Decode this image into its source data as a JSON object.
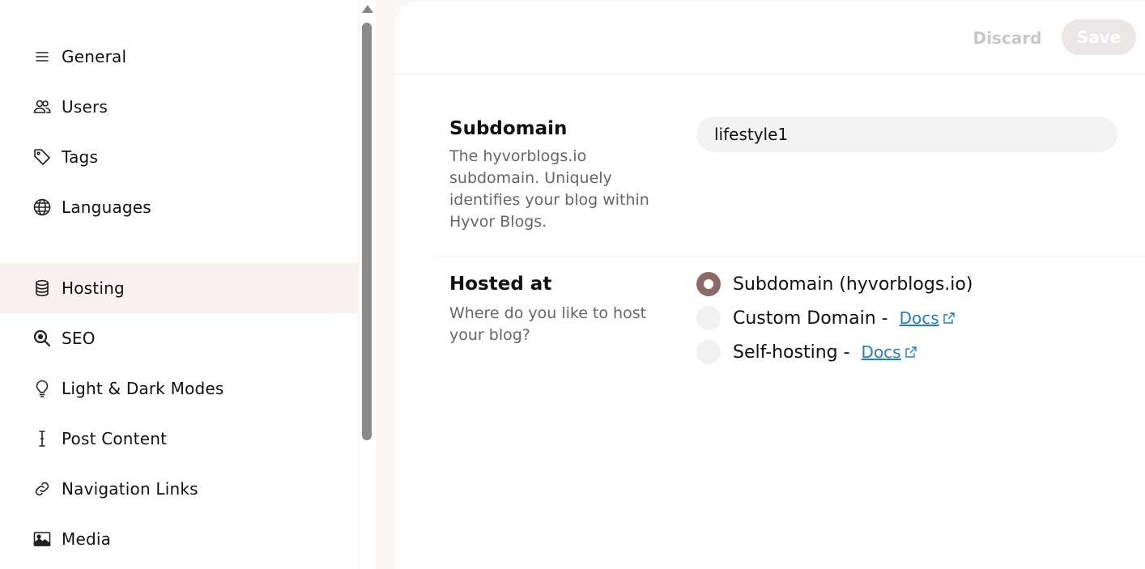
{
  "sidebar": {
    "items": [
      {
        "label": "General",
        "icon": "list-icon",
        "active": false
      },
      {
        "label": "Users",
        "icon": "users-icon",
        "active": false
      },
      {
        "label": "Tags",
        "icon": "tag-icon",
        "active": false
      },
      {
        "label": "Languages",
        "icon": "globe-icon",
        "active": false
      },
      {
        "label": "Hosting",
        "icon": "database-icon",
        "active": true
      },
      {
        "label": "SEO",
        "icon": "search-icon",
        "active": false
      },
      {
        "label": "Light & Dark Modes",
        "icon": "lightbulb-icon",
        "active": false
      },
      {
        "label": "Post Content",
        "icon": "text-cursor-icon",
        "active": false
      },
      {
        "label": "Navigation Links",
        "icon": "link-icon",
        "active": false
      },
      {
        "label": "Media",
        "icon": "image-icon",
        "active": false
      }
    ]
  },
  "header": {
    "discard_label": "Discard",
    "save_label": "Save"
  },
  "subdomain": {
    "title": "Subdomain",
    "description": "The hyvorblogs.io subdomain. Uniquely identifies your blog within Hyvor Blogs.",
    "value": "lifestyle1"
  },
  "hosting": {
    "title": "Hosted at",
    "description": "Where do you like to host your blog?",
    "options": [
      {
        "label": "Subdomain (hyvorblogs.io)",
        "selected": true
      },
      {
        "label": "Custom Domain -",
        "link": "Docs",
        "selected": false
      },
      {
        "label": "Self-hosting -",
        "link": "Docs",
        "selected": false
      }
    ]
  },
  "colors": {
    "accent": "#8c6b66",
    "link": "#1f7fbf",
    "active_bg": "#f7f2ef"
  }
}
